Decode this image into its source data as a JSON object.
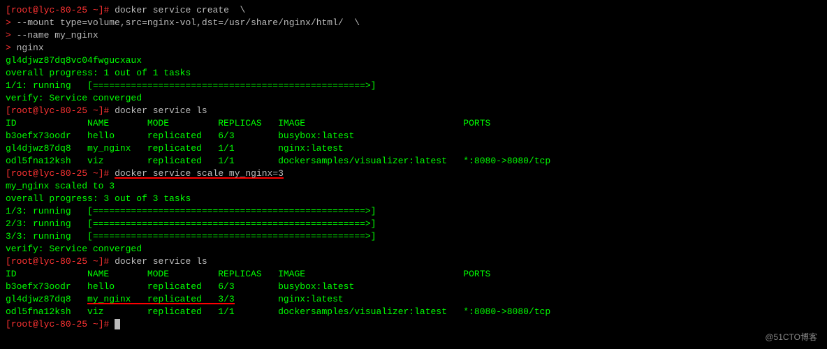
{
  "prompt": {
    "user": "root",
    "host": "lyc-80-25",
    "path": "~",
    "prefix_open": "[",
    "prefix_at": "@",
    "prefix_sep": " ",
    "prefix_close": "]#",
    "continuation": ">"
  },
  "commands": {
    "create_l1": "docker service create  \\",
    "create_l2": "--mount type=volume,src=nginx-vol,dst=/usr/share/nginx/html/  \\",
    "create_l3": "--name my_nginx",
    "create_l4": "nginx",
    "ls1": "docker service ls",
    "scale": "docker service scale my_nginx=3",
    "ls2": "docker service ls",
    "empty": ""
  },
  "create_output": {
    "task_id": "gl4djwz87dq8vc04fwgucxaux",
    "progress": "overall progress: 1 out of 1 tasks",
    "running": "1/1: running   [==================================================>]",
    "verify": "verify: Service converged"
  },
  "ls1_output": {
    "header": "ID             NAME       MODE         REPLICAS   IMAGE                             PORTS",
    "r1": "b3oefx73oodr   hello      replicated   6/3        busybox:latest                    ",
    "r2": "gl4djwz87dq8   my_nginx   replicated   1/1        nginx:latest                      ",
    "r3": "odl5fna12ksh   viz        replicated   1/1        dockersamples/visualizer:latest   *:8080->8080/tcp"
  },
  "scale_output": {
    "scaled": "my_nginx scaled to 3",
    "progress": "overall progress: 3 out of 3 tasks",
    "r1": "1/3: running   [==================================================>]",
    "r2": "2/3: running   [==================================================>]",
    "r3": "3/3: running   [==================================================>]",
    "verify": "verify: Service converged"
  },
  "ls2_output": {
    "header": "ID             NAME       MODE         REPLICAS   IMAGE                             PORTS",
    "r1": {
      "full": "b3oefx73oodr   hello      replicated   6/3        busybox:latest                    "
    },
    "r2": {
      "p1": "gl4djwz87dq8   ",
      "hl": "my_nginx   replicated   3/3",
      "p2": "        nginx:latest                      "
    },
    "r3": {
      "full": "odl5fna12ksh   viz        replicated   1/1        dockersamples/visualizer:latest   *:8080->8080/tcp"
    }
  },
  "watermark": "@51CTO博客",
  "chart_data": {
    "type": "table",
    "title": "docker service ls (after scale)",
    "columns": [
      "ID",
      "NAME",
      "MODE",
      "REPLICAS",
      "IMAGE",
      "PORTS"
    ],
    "rows": [
      [
        "b3oefx73oodr",
        "hello",
        "replicated",
        "6/3",
        "busybox:latest",
        ""
      ],
      [
        "gl4djwz87dq8",
        "my_nginx",
        "replicated",
        "3/3",
        "nginx:latest",
        ""
      ],
      [
        "odl5fna12ksh",
        "viz",
        "replicated",
        "1/1",
        "dockersamples/visualizer:latest",
        "*:8080->8080/tcp"
      ]
    ]
  }
}
